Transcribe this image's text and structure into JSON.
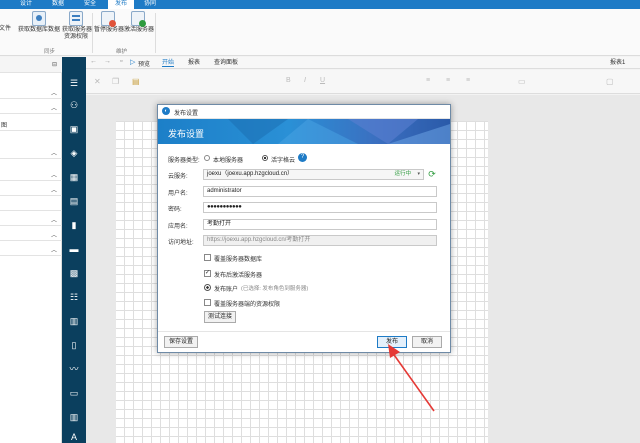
{
  "menu": {
    "tabs": [
      "设计",
      "数据",
      "安全",
      "发布",
      "协同"
    ],
    "active_index": 3
  },
  "ribbon": {
    "items": [
      {
        "label_line1": "文件",
        "label_line2": "",
        "icon": "file-icon"
      },
      {
        "label_line1": "获取数据库数据",
        "label_line2": "",
        "icon": "database-download-icon"
      },
      {
        "label_line1": "获取服务器",
        "label_line2": "资源权限",
        "icon": "server-permission-icon"
      },
      {
        "label_line1": "暂停服务器",
        "label_line2": "",
        "icon": "pause-server-icon"
      },
      {
        "label_line1": "激活服务器",
        "label_line2": "",
        "icon": "activate-server-icon"
      }
    ],
    "groups": [
      "同步",
      "维护"
    ]
  },
  "leftpanel": {
    "row_text": "图"
  },
  "toolstrip": {
    "preview_label": "预览"
  },
  "formatbar": {
    "tabs": [
      "开始",
      "报表",
      "查询面板"
    ],
    "report_name": "报表1"
  },
  "dialog": {
    "title": "发布设置",
    "header": "发布设置",
    "server_type_label": "服务器类型:",
    "server_type_options": [
      "本地服务器",
      "活字格云"
    ],
    "server_type_selected": "活字格云",
    "cloud_server_label": "云服务:",
    "cloud_server_value": "joexu（joexu.app.hzgcloud.cn）",
    "cloud_status": "运行中",
    "username_label": "用户名:",
    "username_value": "administrator",
    "password_label": "密码:",
    "password_value": "●●●●●●●●●●●",
    "appname_label": "应用名:",
    "appname_value": "考勤打开",
    "url_label": "访问地址:",
    "url_value": "https://joexu.app.hzgcloud.cn/考勤打开",
    "options": {
      "overwrite_db": "覆盖服务器数据库",
      "activate_after": "发布后激活服务器",
      "publish_accounts": "发布账户",
      "publish_accounts_hint": "(已选择: 发布角色到服务器)",
      "overwrite_permissions": "覆盖服务器端的资源权限"
    },
    "test_button": "测试连接",
    "save_button": "保存设置",
    "publish_button": "发布",
    "cancel_button": "取消"
  },
  "colors": {
    "accent": "#1e7bc6",
    "sidebar": "#0b3f5e",
    "arrow": "#e53935",
    "status_green": "#2e9b3e"
  }
}
